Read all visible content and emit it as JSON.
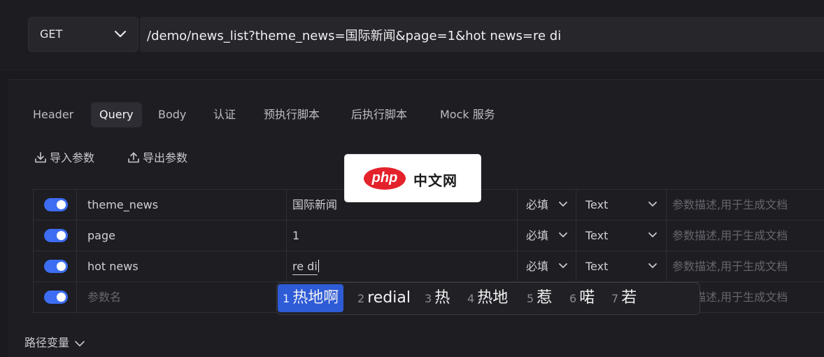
{
  "request": {
    "method": "GET",
    "url": "/demo/news_list?theme_news=国际新闻&page=1&hot news=re di"
  },
  "tabs": [
    {
      "label": "Header",
      "active": false
    },
    {
      "label": "Query",
      "active": true
    },
    {
      "label": "Body",
      "active": false
    },
    {
      "label": "认证",
      "active": false
    },
    {
      "label": "预执行脚本",
      "active": false
    },
    {
      "label": "后执行脚本",
      "active": false
    },
    {
      "label": "Mock 服务",
      "active": false
    }
  ],
  "actions": {
    "import_label": "导入参数",
    "export_label": "导出参数"
  },
  "params": {
    "rows": [
      {
        "enabled": true,
        "name": "theme_news",
        "value": "国际新闻",
        "required": "必填",
        "type": "Text",
        "description_placeholder": "参数描述,用于生成文档"
      },
      {
        "enabled": true,
        "name": "page",
        "value": "1",
        "required": "必填",
        "type": "Text",
        "description_placeholder": "参数描述,用于生成文档"
      },
      {
        "enabled": true,
        "name": "hot news",
        "value": "re di",
        "required": "必填",
        "type": "Text",
        "description_placeholder": "参数描述,用于生成文档"
      }
    ],
    "new_row": {
      "enabled": true,
      "name_placeholder": "参数名",
      "description_placeholder": "参数描述,用于生成文档"
    }
  },
  "watermark": {
    "badge": "php",
    "text": "中文网"
  },
  "ime": {
    "candidates": [
      {
        "num": "1",
        "text": "热地啊",
        "selected": true
      },
      {
        "num": "2",
        "text": "redial",
        "selected": false
      },
      {
        "num": "3",
        "text": "热",
        "selected": false
      },
      {
        "num": "4",
        "text": "热地",
        "selected": false
      },
      {
        "num": "5",
        "text": "惹",
        "selected": false
      },
      {
        "num": "6",
        "text": "喏",
        "selected": false
      },
      {
        "num": "7",
        "text": "若",
        "selected": false
      }
    ]
  },
  "path_variables": {
    "label": "路径变量"
  },
  "colors": {
    "accent": "#3d6df2",
    "ime_selected": "#2e5bd6",
    "logo_red": "#e4222b"
  }
}
